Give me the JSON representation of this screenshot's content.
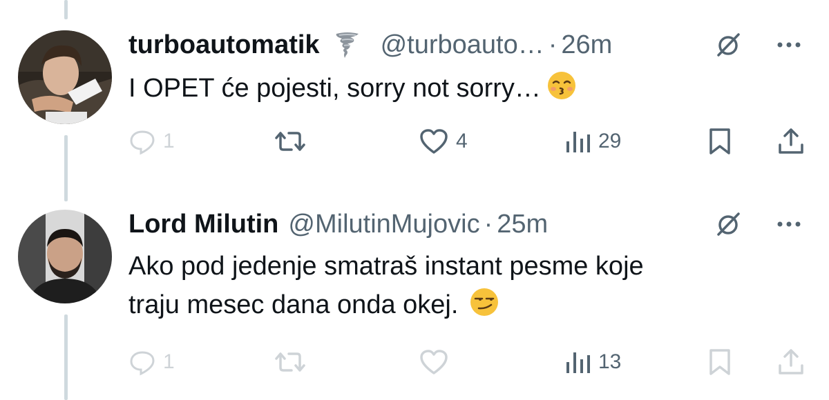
{
  "tweets": [
    {
      "display_name": "turboautomatik",
      "badge_icon": "tornado-icon",
      "handle": "@turboauto…",
      "separator": "·",
      "time": "26m",
      "text": "I OPET će pojesti, sorry not sorry…",
      "emoji": "kissing-face-with-closed-eyes",
      "actions": {
        "reply_count": "1",
        "retweet_count": "",
        "like_count": "4",
        "views_count": "29"
      }
    },
    {
      "display_name": "Lord Milutin",
      "handle": "@MilutinMujovic",
      "separator": "·",
      "time": "25m",
      "text_line1": "Ako pod jedenje smatraš instant pesme koje",
      "text_line2": "traju mesec dana onda okej.",
      "emoji": "smirking-face",
      "actions": {
        "reply_count": "1",
        "retweet_count": "",
        "like_count": "",
        "views_count": "13"
      }
    }
  ],
  "colors": {
    "text": "#0f1419",
    "secondary": "#536471",
    "thread_line": "#cfd9de",
    "emoji_yellow": "#f7c23b"
  }
}
